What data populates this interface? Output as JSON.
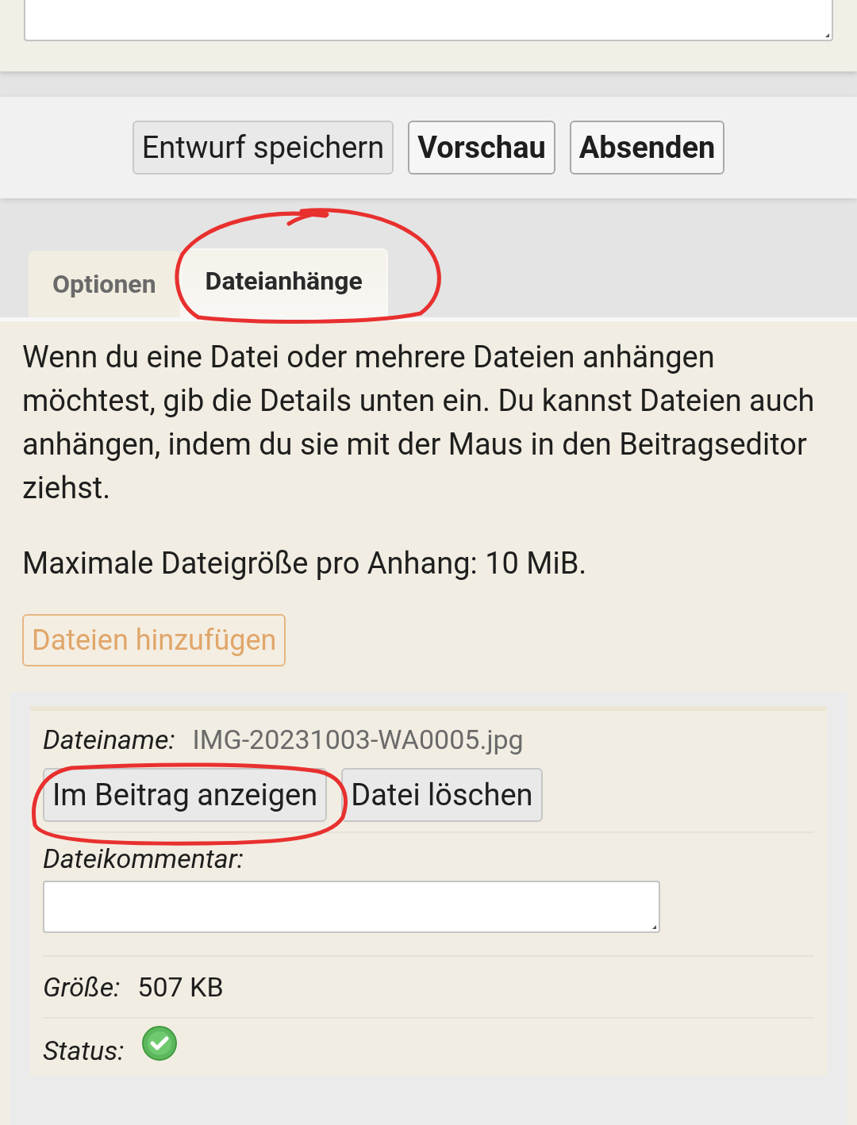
{
  "buttons": [
    {
      "label": "Entwurf speichern",
      "primary": false
    },
    {
      "label": "Vorschau",
      "primary": true
    },
    {
      "label": "Absenden",
      "primary": true
    }
  ],
  "tabs": [
    {
      "label": "Optionen",
      "selected": false
    },
    {
      "label": "Dateianhänge",
      "selected": true
    }
  ],
  "intro": "Wenn du eine Datei oder mehrere Dateien anhängen möchtest, gib die Details unten ein. Du kannst Dateien auch anhängen, indem du sie mit der Maus in den Beitragseditor ziehst.",
  "max_size": "Maximale Dateigröße pro Anhang: 10 MiB.",
  "add_button": "Dateien hinzufügen",
  "attachment": {
    "filename_label": "Dateiname:",
    "filename": "IMG-20231003-WA0005.jpg",
    "buttons": [
      "Im Beitrag anzeigen",
      "Datei löschen"
    ],
    "comment_label": "Dateikommentar:",
    "size_label": "Größe:",
    "size": "507 KB",
    "status_label": "Status:",
    "status_ok": true
  },
  "annotations": [
    {
      "kind": "circle"
    },
    {
      "kind": "circle"
    }
  ]
}
